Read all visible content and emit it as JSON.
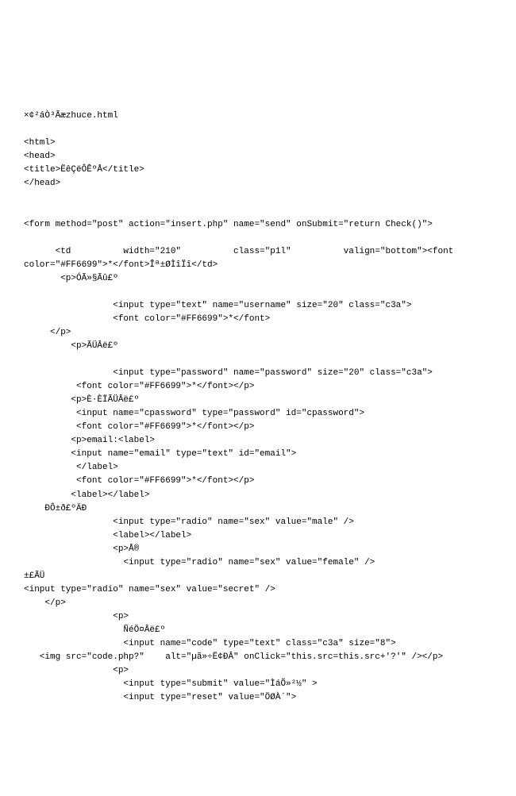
{
  "lines": [
    "×¢²áÒ³Ãæzhuce.html",
    "",
    "<html>",
    "<head>",
    "<title>ËêÇëÔÊºÅ</title>",
    "</head>",
    "",
    "",
    "<form method=\"post\" action=\"insert.php\" name=\"send\" onSubmit=\"return Check()\">",
    "",
    "      <td          width=\"210\"          class=\"p1l\"          valign=\"bottom\"><font",
    "color=\"#FF6699\">*</font>Îª±ØÌîÏî</td>",
    "       <p>ÓÃ»§Ãû£º",
    "",
    "                 <input type=\"text\" name=\"username\" size=\"20\" class=\"c3a\">",
    "                 <font color=\"#FF6699\">*</font>",
    "     </p>",
    "         <p>ÃÜÂë£º",
    "",
    "                 <input type=\"password\" name=\"password\" size=\"20\" class=\"c3a\">",
    "          <font color=\"#FF6699\">*</font></p>",
    "         <p>È·ÈÏÃÜÂë£º",
    "          <input name=\"cpassword\" type=\"password\" id=\"cpassword\">",
    "          <font color=\"#FF6699\">*</font></p>",
    "         <p>email:<label>",
    "         <input name=\"email\" type=\"text\" id=\"email\">",
    "          </label>",
    "          <font color=\"#FF6699\">*</font></p>",
    "         <label></label>",
    "    ÐÔ±ð£ºÄÐ",
    "                 <input type=\"radio\" name=\"sex\" value=\"male\" />",
    "                 <label></label>",
    "                 <p>Å®",
    "                   <input type=\"radio\" name=\"sex\" value=\"female\" />",
    "±£ÃÜ",
    "<input type=\"radio\" name=\"sex\" value=\"secret\" />",
    "    </p>",
    "                 <p>",
    "                   ÑéÖ¤Âë£º",
    "                   <input name=\"code\" type=\"text\" class=\"c3a\" size=\"8\">",
    "   <img src=\"code.php?\"    alt=\"µã»÷Ë¢ÐÂ\" onClick=\"this.src=this.src+'?'\" /></p>",
    "                 <p>",
    "                   <input type=\"submit\" value=\"ÌáÕ»²½\" >",
    "                   <input type=\"reset\" value=\"ÖØÀ´\">"
  ]
}
